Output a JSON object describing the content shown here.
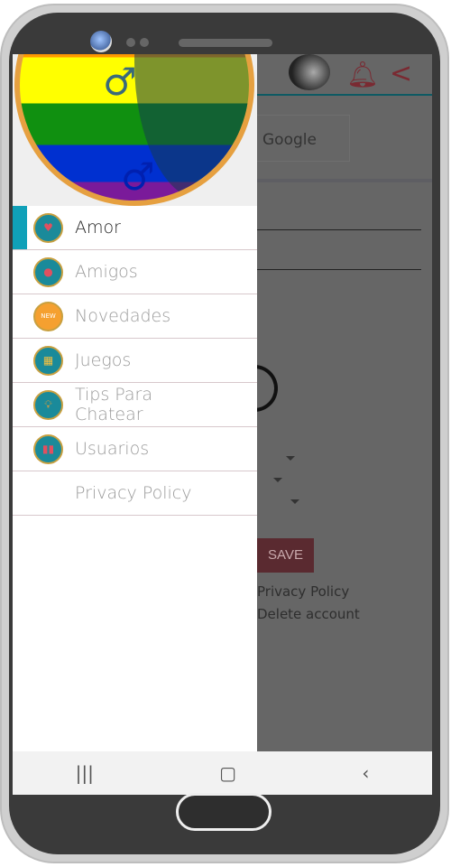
{
  "background": {
    "google_label": "Google",
    "save_label": "SAVE",
    "privacy_link": "Privacy Policy",
    "delete_link": "Delete account"
  },
  "drawer": {
    "items": [
      {
        "label": "Amor",
        "icon": "hearts-chat-icon",
        "active": true
      },
      {
        "label": "Amigos",
        "icon": "chat-bubbles-icon"
      },
      {
        "label": "Novedades",
        "icon": "new-badge-icon"
      },
      {
        "label": "Juegos",
        "icon": "slot-machine-icon"
      },
      {
        "label": "Tips Para Chatear",
        "icon": "lightbulb-icon"
      },
      {
        "label": "Usuarios",
        "icon": "users-icon"
      },
      {
        "label": "Privacy Policy"
      }
    ]
  },
  "navbar": {
    "recent": "|||",
    "home": "▢",
    "back": "‹"
  },
  "colors": {
    "accent": "#10a0b8",
    "brand": "#7a2a32"
  }
}
